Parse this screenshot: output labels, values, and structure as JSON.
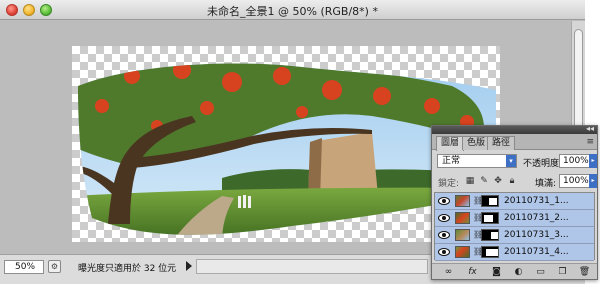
{
  "window": {
    "title": "未命名_全景1 @ 50% (RGB/8*) *"
  },
  "status_bar": {
    "zoom": "50%",
    "info": "曝光度只適用於 32 位元"
  },
  "layers_panel": {
    "tabs": [
      {
        "label": "圖層",
        "active": true
      },
      {
        "label": "色版",
        "active": false
      },
      {
        "label": "路徑",
        "active": false
      }
    ],
    "blend_mode": "正常",
    "opacity_label": "不透明度:",
    "opacity_value": "100%",
    "lock_label": "鎖定:",
    "fill_label": "填滿:",
    "fill_value": "100%",
    "layers": [
      {
        "name": "20110731_1...",
        "visible": true
      },
      {
        "name": "20110731_2...",
        "visible": true
      },
      {
        "name": "20110731_3...",
        "visible": true
      },
      {
        "name": "20110731_4...",
        "visible": true
      }
    ],
    "footer_icons": [
      "link-layers-icon",
      "fx-icon",
      "add-mask-icon",
      "adjustment-layer-icon",
      "group-folder-icon",
      "new-layer-icon",
      "trash-icon"
    ]
  },
  "colors": {
    "selection_blue": "#b0c6e8",
    "sky": "#8fc1e8",
    "grass": "#5d8f2e",
    "flame_tree_blossom": "#d8431f"
  }
}
